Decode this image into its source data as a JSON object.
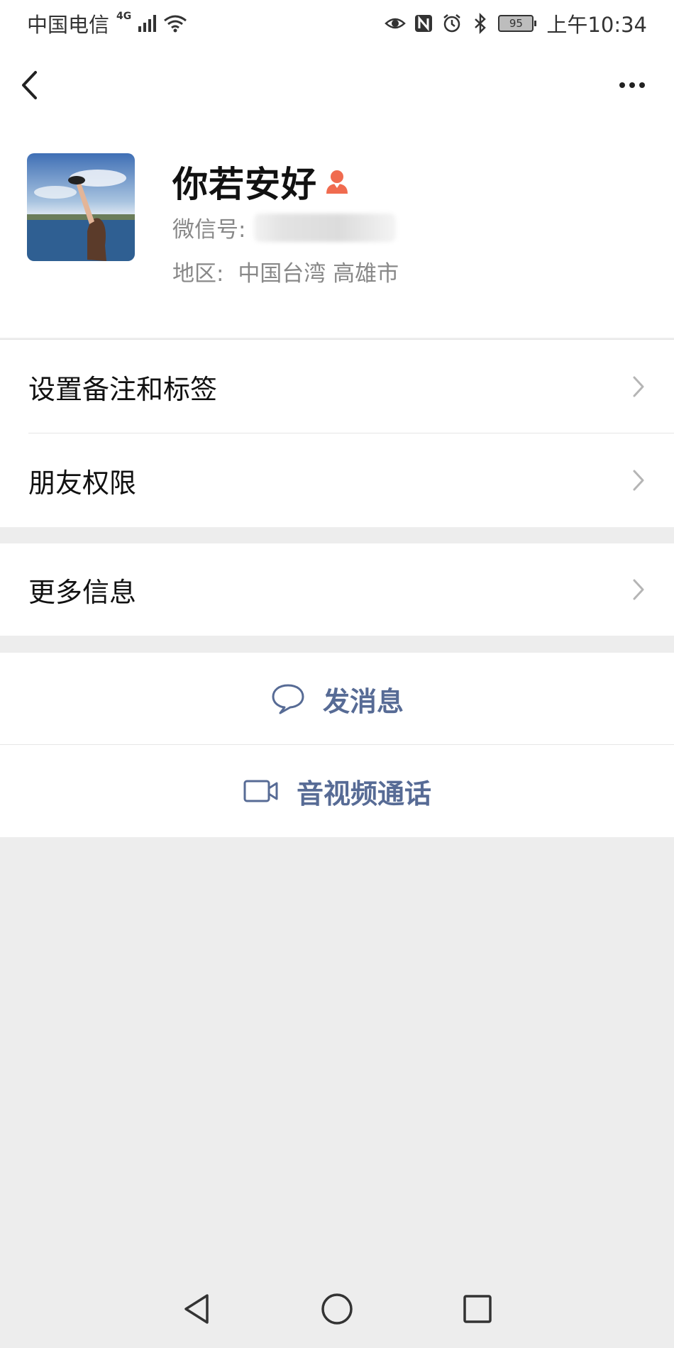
{
  "status_bar": {
    "carrier": "中国电信",
    "network": "4G",
    "battery": "95",
    "time": "上午10:34"
  },
  "profile": {
    "name": "你若安好",
    "wechat_id_label": "微信号:",
    "region_label": "地区:",
    "region_value": "中国台湾  高雄市"
  },
  "menu": {
    "items": [
      {
        "label": "设置备注和标签"
      },
      {
        "label": "朋友权限"
      },
      {
        "label": "更多信息"
      }
    ]
  },
  "actions": {
    "send_message": "发消息",
    "video_call": "音视频通话"
  },
  "colors": {
    "accent": "#576b95",
    "background": "#ededed",
    "badge": "#f06b4f"
  }
}
